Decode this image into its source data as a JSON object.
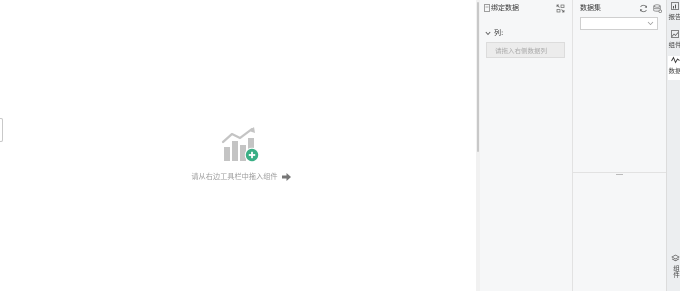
{
  "canvas": {
    "empty_hint": "请从右边工具栏中拖入组件"
  },
  "binding_panel": {
    "title": "绑定数据",
    "columns_label": "列:",
    "drop_placeholder": "请拖入右侧数据列"
  },
  "dataset_panel": {
    "title": "数据集",
    "selected_value": ""
  },
  "rail": {
    "tabs": [
      {
        "label": "报告",
        "icon": "report-icon"
      },
      {
        "label": "组件",
        "icon": "chart-image-icon"
      },
      {
        "label": "数据",
        "icon": "data-line-icon"
      }
    ],
    "bottom_label": "组件"
  },
  "colors": {
    "accent": "#3aaf85",
    "icon_gray": "#c4c4c4"
  }
}
